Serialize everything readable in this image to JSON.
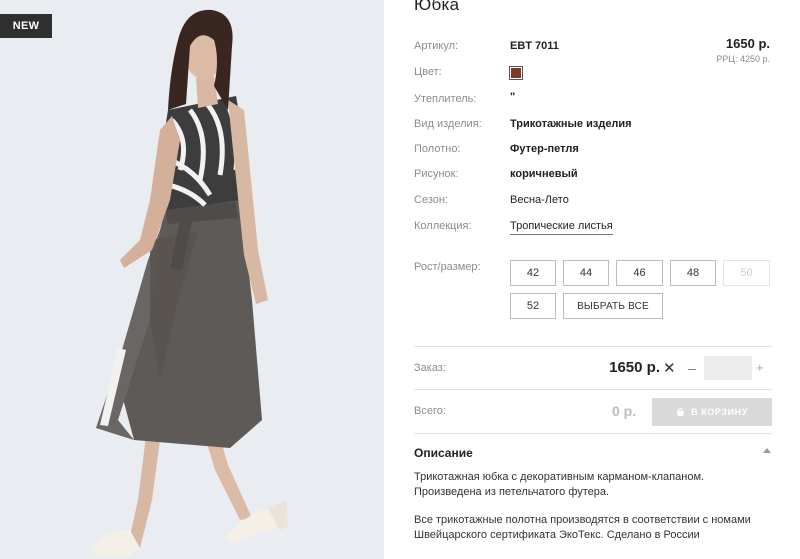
{
  "badge": "NEW",
  "product": {
    "title": "Юбка",
    "price": "1650 р.",
    "rrp": "РРЦ: 4250 р."
  },
  "attributes": {
    "article_label": "Артикул:",
    "article_value": "EBT 7011",
    "color_label": "Цвет:",
    "color_hex": "#7a3b2a",
    "insulation_label": "Утеплитель:",
    "insulation_value": "\"",
    "type_label": "Вид изделия:",
    "type_value": "Трикотажные изделия",
    "fabric_label": "Полотно:",
    "fabric_value": "Футер-петля",
    "pattern_label": "Рисунок:",
    "pattern_value": "коричневый",
    "season_label": "Сезон:",
    "season_value": "Весна-Лето",
    "collection_label": "Коллекция:",
    "collection_value": "Тропические листья"
  },
  "sizes": {
    "label": "Рост/размер:",
    "options": [
      "42",
      "44",
      "46",
      "48",
      "50",
      "52"
    ],
    "select_all": "ВЫБРАТЬ ВСЕ"
  },
  "order": {
    "label": "Заказ:",
    "price": "1650 р.",
    "times": "✕",
    "minus": "–",
    "plus": "+",
    "quantity": ""
  },
  "total": {
    "label": "Всего:",
    "value": "0 р.",
    "cart_button": "В КОРЗИНУ"
  },
  "description": {
    "title": "Описание",
    "paragraph1_line1": "Трикотажная юбка с декоративным карманом-клапаном.",
    "paragraph1_line2": "Произведена из петельчатого футера.",
    "paragraph2_line1": "Все трикотажные полотна производятся в соответствии с номами",
    "paragraph2_line2": "Швейцарского сертификата ЭкоТекс. Сделано в России"
  },
  "icons": {
    "cart": "cart-icon",
    "collapse": "chevron-up-icon"
  },
  "colors": {
    "photo_background": "#e9ecf0",
    "cart_button": "#d9d9d9",
    "badge": "#2f2f2f"
  }
}
